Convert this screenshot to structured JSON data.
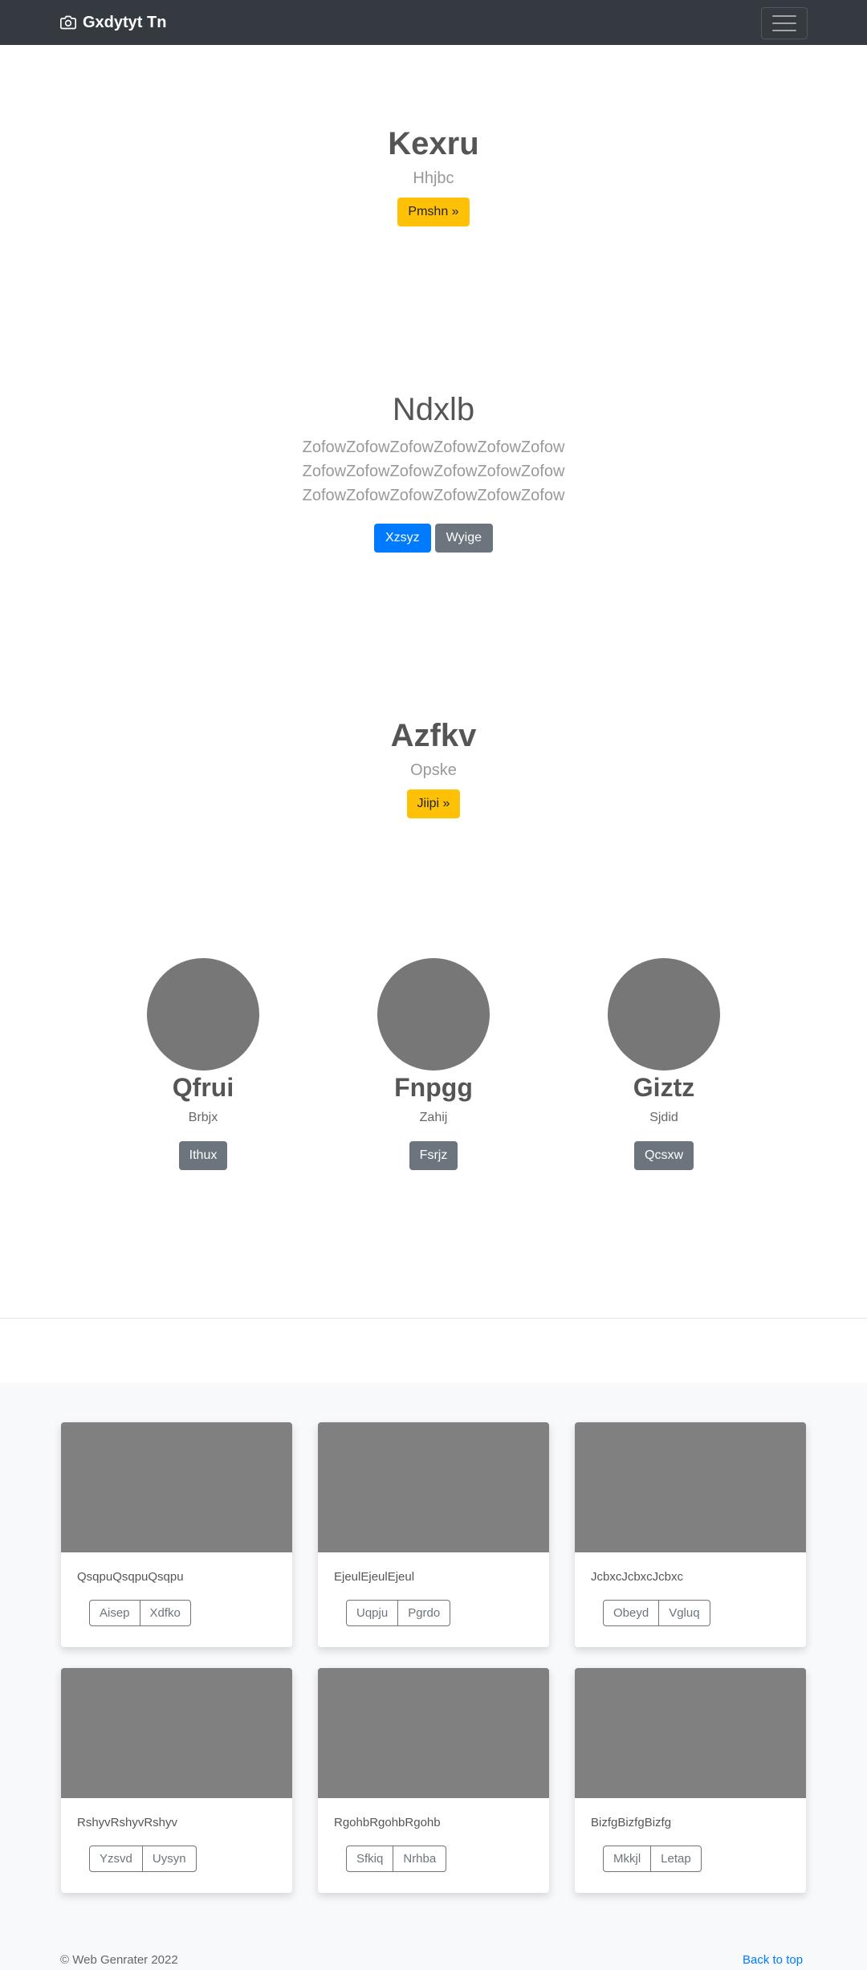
{
  "navbar": {
    "brand": "Gxdytyt Tn"
  },
  "hero1": {
    "title": "Kexru",
    "subtitle": "Hhjbc",
    "button": "Pmshn »"
  },
  "hero2": {
    "title": "Ndxlb",
    "lines": [
      "ZofowZofowZofowZofowZofowZofow",
      "ZofowZofowZofowZofowZofowZofow",
      "ZofowZofowZofowZofowZofowZofow"
    ],
    "primary_button": "Xzsyz",
    "secondary_button": "Wyige"
  },
  "hero3": {
    "title": "Azfkv",
    "subtitle": "Opske",
    "button": "Jiipi »"
  },
  "features": [
    {
      "name": "Qfrui",
      "sub": "Brbjx",
      "button": "Ithux"
    },
    {
      "name": "Fnpgg",
      "sub": "Zahij",
      "button": "Fsrjz"
    },
    {
      "name": "Giztz",
      "sub": "Sjdid",
      "button": "Qcsxw"
    }
  ],
  "cards": [
    {
      "text": "QsqpuQsqpuQsqpu",
      "btn1": "Aisep",
      "btn2": "Xdfko"
    },
    {
      "text": "EjeulEjeulEjeul",
      "btn1": "Uqpju",
      "btn2": "Pgrdo"
    },
    {
      "text": "JcbxcJcbxcJcbxc",
      "btn1": "Obeyd",
      "btn2": "Vgluq"
    },
    {
      "text": "RshyvRshyvRshyv",
      "btn1": "Yzsvd",
      "btn2": "Uysyn"
    },
    {
      "text": "RgohbRgohbRgohb",
      "btn1": "Sfkiq",
      "btn2": "Nrhba"
    },
    {
      "text": "BizfgBizfgBizfg",
      "btn1": "Mkkjl",
      "btn2": "Letap"
    }
  ],
  "footer": {
    "copyright": "© Web Genrater 2022",
    "back_to_top": "Back to top"
  },
  "colors": {
    "navbar": "#343a40",
    "warning": "#ffc107",
    "primary": "#007bff",
    "secondary": "#6c757d"
  }
}
